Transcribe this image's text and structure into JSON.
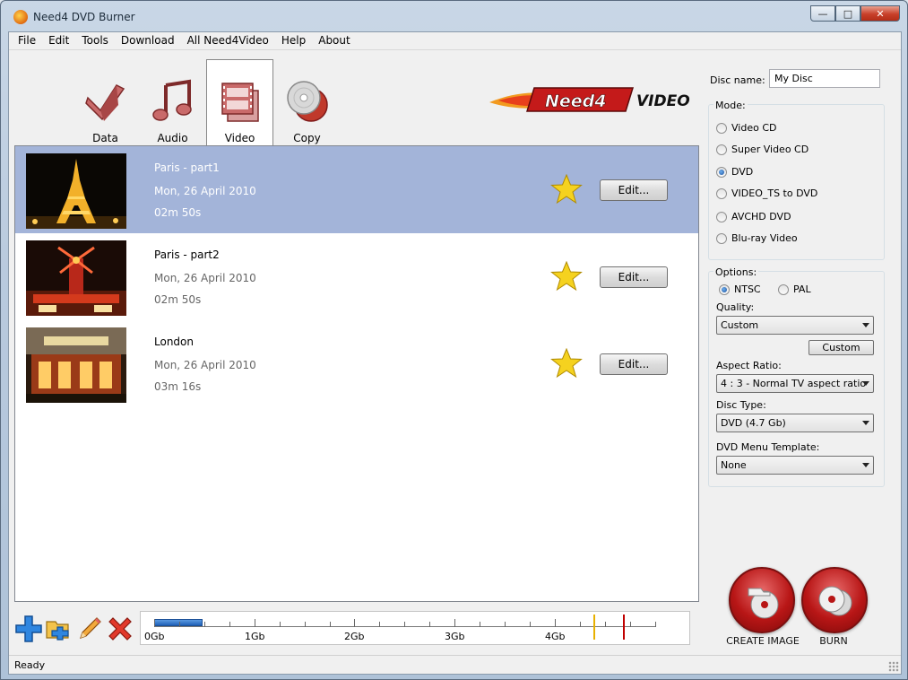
{
  "window": {
    "title": "Need4 DVD Burner"
  },
  "menu": [
    "File",
    "Edit",
    "Tools",
    "Download",
    "All Need4Video",
    "Help",
    "About"
  ],
  "tabs": [
    {
      "label": "Data",
      "icon": "data-icon"
    },
    {
      "label": "Audio",
      "icon": "music-note-icon"
    },
    {
      "label": "Video",
      "icon": "film-icon"
    },
    {
      "label": "Copy",
      "icon": "disc-copy-icon"
    }
  ],
  "logo": {
    "text_brand": "Need4",
    "text_product": "VIDEO"
  },
  "videos": [
    {
      "name": "Paris - part1",
      "date": "Mon, 26 April 2010",
      "duration": "02m 50s",
      "edit_label": "Edit...",
      "selected": true
    },
    {
      "name": "Paris - part2",
      "date": "Mon, 26 April 2010",
      "duration": "02m 50s",
      "edit_label": "Edit...",
      "selected": false
    },
    {
      "name": "London",
      "date": "Mon, 26 April 2010",
      "duration": "03m 16s",
      "edit_label": "Edit...",
      "selected": false
    }
  ],
  "capacity": {
    "labels": [
      "0Gb",
      "1Gb",
      "2Gb",
      "3Gb",
      "4Gb"
    ],
    "used_gb": 0.5
  },
  "disc": {
    "name_label": "Disc name:",
    "name_value": "My Disc",
    "mode_label": "Mode:",
    "modes": [
      {
        "label": "Video CD",
        "checked": false
      },
      {
        "label": "Super Video CD",
        "checked": false
      },
      {
        "label": "DVD",
        "checked": true
      },
      {
        "label": "VIDEO_TS to DVD",
        "checked": false
      },
      {
        "label": "AVCHD DVD",
        "checked": false
      },
      {
        "label": "Blu-ray Video",
        "checked": false
      }
    ]
  },
  "options": {
    "label": "Options:",
    "ntsc": "NTSC",
    "pal": "PAL",
    "quality_label": "Quality:",
    "quality_value": "Custom",
    "custom_button": "Custom",
    "aspect_label": "Aspect Ratio:",
    "aspect_value": "4 : 3 - Normal TV aspect ratio",
    "disc_type_label": "Disc Type:",
    "disc_type_value": "DVD (4.7 Gb)",
    "menu_template_label": "DVD Menu Template:",
    "menu_template_value": "None"
  },
  "actions": {
    "create_image": "CREATE IMAGE",
    "burn": "BURN"
  },
  "status": "Ready",
  "colors": {
    "selected_row": "#a3b4d9",
    "accent_red": "#b81616",
    "capacity_blue": "#1f61b8"
  }
}
